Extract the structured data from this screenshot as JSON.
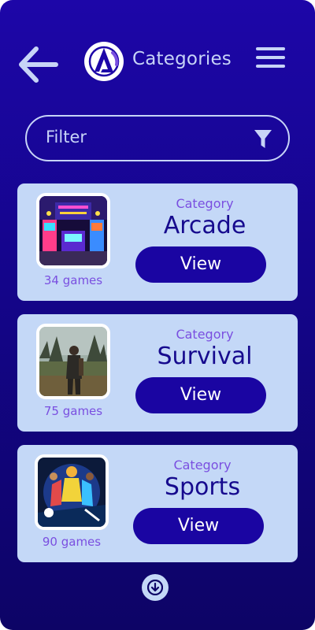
{
  "header": {
    "title": "Categories",
    "back_icon": "arrow-left-icon",
    "logo_icon": "app-logo",
    "menu_icon": "hamburger-menu-icon"
  },
  "filter": {
    "placeholder": "Filter",
    "icon": "funnel-icon"
  },
  "categories": [
    {
      "label": "Category",
      "name": "Arcade",
      "games": "34 games",
      "button": "View",
      "image": "arcade-image"
    },
    {
      "label": "Category",
      "name": "Survival",
      "games": "75 games",
      "button": "View",
      "image": "survival-image"
    },
    {
      "label": "Category",
      "name": "Sports",
      "games": "90 games",
      "button": "View",
      "image": "sports-image"
    }
  ],
  "scroll": {
    "icon": "arrow-down-icon"
  },
  "colors": {
    "background": "#1d06a8",
    "card": "#c4d8f7",
    "button": "#1a05a2",
    "accent_text": "#7a4fe0",
    "title_text": "#160a8e",
    "header_text": "#c7d4f7"
  }
}
